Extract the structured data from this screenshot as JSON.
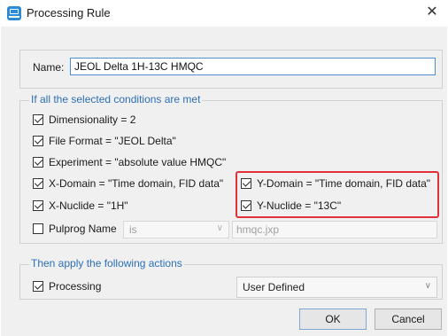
{
  "window": {
    "title": "Processing Rule",
    "close_glyph": "✕",
    "icon": "app-icon"
  },
  "name": {
    "label": "Name:",
    "value": "JEOL Delta 1H-13C HMQC"
  },
  "conditions": {
    "title": "If all the selected conditions are met",
    "items": [
      {
        "label": "Dimensionality = 2",
        "checked": true
      },
      {
        "label": "File Format = \"JEOL Delta\"",
        "checked": true
      },
      {
        "label": "Experiment = \"absolute value HMQC\"",
        "checked": true
      },
      {
        "label": "X-Domain = \"Time domain, FID data\"",
        "checked": true
      },
      {
        "label": "Y-Domain = \"Time domain, FID data\"",
        "checked": true
      },
      {
        "label": "X-Nuclide = \"1H\"",
        "checked": true
      },
      {
        "label": "Y-Nuclide = \"13C\"",
        "checked": true
      }
    ],
    "pulprog": {
      "label": "Pulprog Name",
      "checked": false,
      "operator": "is",
      "value": "hmqc.jxp"
    }
  },
  "actions": {
    "title": "Then apply the following actions",
    "processing": {
      "label": "Processing",
      "checked": true,
      "option": "User Defined"
    }
  },
  "buttons": {
    "ok": "OK",
    "cancel": "Cancel"
  },
  "colors": {
    "accent": "#2d6fb7",
    "highlight": "#e0303a"
  }
}
